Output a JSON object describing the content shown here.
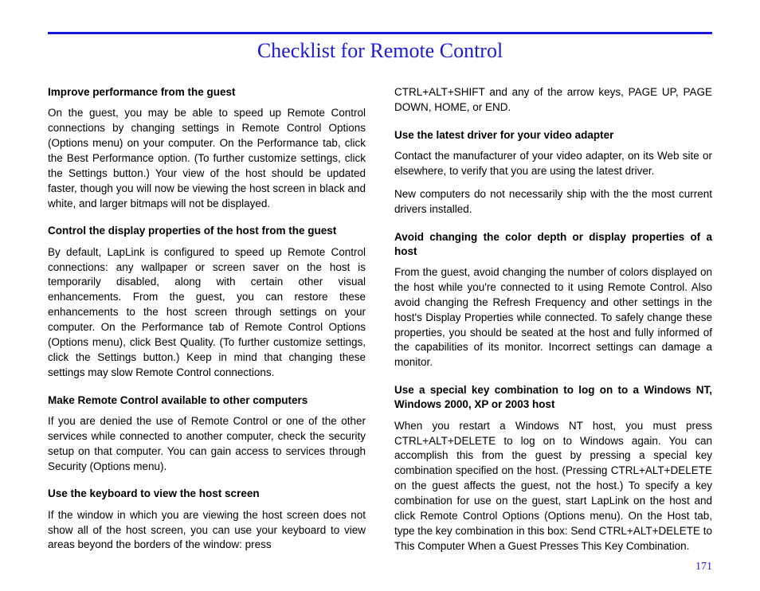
{
  "title": "Checklist for Remote Control",
  "page_number": "171",
  "left": {
    "s1": {
      "head": "Improve performance from the guest",
      "body": "On the guest, you may be able to speed up Remote Control connections by changing settings in Remote Control Options (Options menu) on your computer. On the Performance tab, click the Best Performance option. (To further customize settings, click the Settings button.) Your view of the host should be updated faster, though you will now be viewing the host screen in black and white, and larger bitmaps will not be displayed."
    },
    "s2": {
      "head": "Control the display properties of the host from the guest",
      "body": "By default, LapLink is configured to speed up Remote Control connections: any wallpaper or screen saver on the host is temporarily disabled, along with certain other visual enhancements. From the guest, you can restore these enhancements to the host screen through settings on your computer. On the Performance tab of Remote Control Options (Options menu), click Best Quality. (To further customize settings, click the Settings button.) Keep in mind that changing these settings may slow Remote Control connections."
    },
    "s3": {
      "head": "Make Remote Control available to other computers",
      "body": "If you are denied the use of Remote Control or one of the other services while connected to another computer, check the security setup on that computer. You can gain access to services through Security (Options menu)."
    },
    "s4": {
      "head": "Use the keyboard to view the host screen",
      "body": "If the window in which you are viewing the host screen does not show all of the host screen, you can use your keyboard to view areas beyond the borders of the window: press"
    }
  },
  "right": {
    "cont": "CTRL+ALT+SHIFT and any of the arrow keys, PAGE UP, PAGE DOWN, HOME, or END.",
    "s5": {
      "head": "Use the latest driver for your video adapter",
      "body1": "Contact the manufacturer of your video adapter, on its Web site or elsewhere, to verify that you are using the latest driver.",
      "body2": "New computers do not necessarily ship with the the most current drivers installed."
    },
    "s6": {
      "head": "Avoid changing the color depth or display properties of a host",
      "body": "From the guest, avoid changing the number of colors displayed on the host while you're connected to it using Remote Control. Also avoid changing the Refresh Frequency and other settings in the host's Display Properties while connected. To safely change these properties, you should be seated at the host and fully informed of the capabilities of its monitor. Incorrect settings can damage a monitor."
    },
    "s7": {
      "head": "Use a special key combination to log on to a Windows NT, Windows 2000, XP or 2003 host",
      "body": "When you restart a Windows NT host, you must press CTRL+ALT+DELETE to log on to Windows again. You can accomplish this from the guest by pressing a special key combination specified on the host. (Pressing CTRL+ALT+DELETE on the guest affects the guest, not the host.) To specify a key combination for use on the guest, start LapLink on the host and click Remote Control Options (Options menu). On the Host tab, type the key combination in this box: Send CTRL+ALT+DELETE to This Computer When a Guest Presses This Key Combination."
    }
  }
}
